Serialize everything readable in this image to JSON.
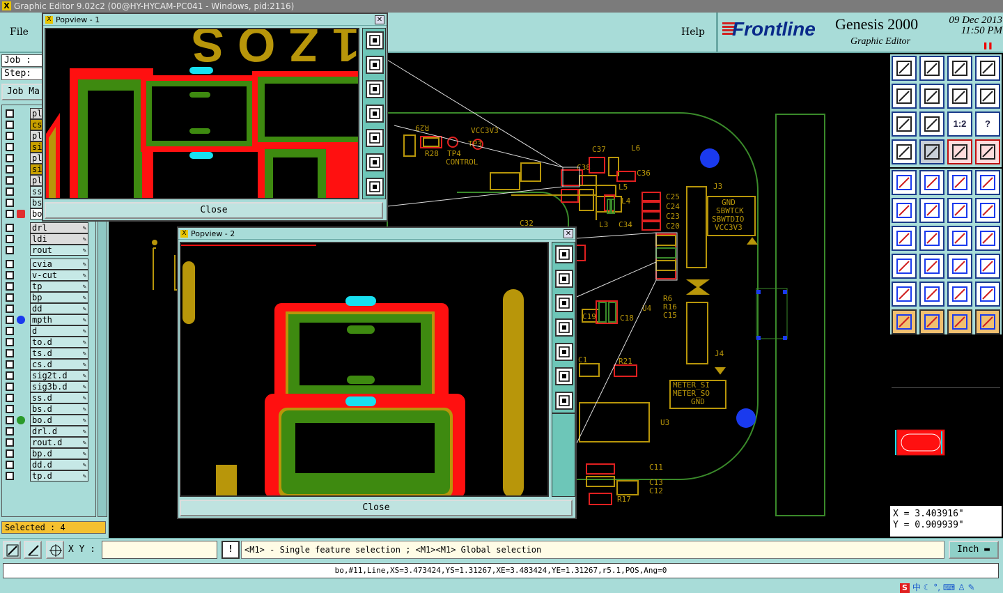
{
  "window": {
    "title": "Graphic Editor 9.02c2 (00@HY-HYCAM-PC041 - Windows, pid:2116)"
  },
  "menu": {
    "file": "File",
    "help": "Help"
  },
  "brand": {
    "logo": "Frontline",
    "product": "Genesis 2000",
    "subtitle": "Graphic Editor",
    "date": "09 Dec 2013",
    "time": "11:50 PM"
  },
  "job": {
    "job_label": "Job :",
    "step_label": "Step:",
    "job_manager_label": "Job Ma"
  },
  "layers": [
    {
      "name": "pl",
      "color": "",
      "alt": true
    },
    {
      "name": "cs",
      "color": "",
      "alt": false,
      "label_bg": "#c8a000"
    },
    {
      "name": "pl",
      "color": "",
      "alt": true
    },
    {
      "name": "si",
      "color": "",
      "alt": false,
      "label_bg": "#c8a000"
    },
    {
      "name": "pl",
      "color": "",
      "alt": true
    },
    {
      "name": "si",
      "color": "",
      "alt": false,
      "label_bg": "#c8a000"
    },
    {
      "name": "pl",
      "color": "",
      "alt": true
    },
    {
      "name": "ss",
      "color": "",
      "alt": false
    },
    {
      "name": "bs",
      "color": "",
      "alt": false
    },
    {
      "name": "bo",
      "color": "",
      "alt": false,
      "selected": true
    },
    {
      "name": "drl",
      "color": "",
      "alt": true
    },
    {
      "name": "ldi",
      "color": "",
      "alt": true
    },
    {
      "name": "rout",
      "color": "",
      "alt": false
    },
    {
      "name": "cvia",
      "color": "",
      "alt": false
    },
    {
      "name": "v-cut",
      "color": "",
      "alt": false
    },
    {
      "name": "tp",
      "color": "",
      "alt": false
    },
    {
      "name": "bp",
      "color": "",
      "alt": false
    },
    {
      "name": "dd",
      "color": "",
      "alt": false
    },
    {
      "name": "mpth",
      "color": "#1a3aee",
      "alt": false
    },
    {
      "name": "d",
      "color": "",
      "alt": false
    },
    {
      "name": "to.d",
      "color": "",
      "alt": false
    },
    {
      "name": "ts.d",
      "color": "",
      "alt": false
    },
    {
      "name": "cs.d",
      "color": "",
      "alt": false
    },
    {
      "name": "sig2t.d",
      "color": "",
      "alt": false
    },
    {
      "name": "sig3b.d",
      "color": "",
      "alt": false
    },
    {
      "name": "ss.d",
      "color": "",
      "alt": false
    },
    {
      "name": "bs.d",
      "color": "",
      "alt": false
    },
    {
      "name": "bo.d",
      "color": "#2a9a2a",
      "alt": false
    },
    {
      "name": "drl.d",
      "color": "",
      "alt": false
    },
    {
      "name": "rout.d",
      "color": "",
      "alt": false
    },
    {
      "name": "bp.d",
      "color": "",
      "alt": false
    },
    {
      "name": "dd.d",
      "color": "",
      "alt": false
    },
    {
      "name": "tp.d",
      "color": "",
      "alt": false
    }
  ],
  "selected_label": "Selected : 4",
  "popview1": {
    "title": "Popview - 1",
    "close_label": "Close",
    "text": "1 Z O S"
  },
  "popview2": {
    "title": "Popview - 2",
    "close_label": "Close"
  },
  "board_labels": {
    "r29": "R29",
    "vcc3v3": "VCC3V3",
    "tp3": "TP3",
    "tp4": "TP4",
    "r28": "R28",
    "control": "CONTROL",
    "c37": "C37",
    "l6": "L6",
    "c38": "C38",
    "c36": "C36",
    "l5": "L5",
    "l4": "L4",
    "c34": "C34",
    "l3": "L3",
    "c25": "C25",
    "c24": "C24",
    "c23": "C23",
    "c20": "C20",
    "c32": "C32",
    "j3": "J3",
    "gnd": "GND",
    "sbwtck": "SBWTCK",
    "sbwtdio": "SBWTDIO",
    "vcc3v3b": "VCC3V3",
    "c19": "C19",
    "c18": "C18",
    "r6": "R6",
    "r16": "R16",
    "c15": "C15",
    "u4": "U4",
    "j4": "J4",
    "c1": "C1",
    "r21": "R21",
    "meter_si": "METER_SI",
    "meter_so": "METER_SO",
    "gnd2": "GND",
    "u3": "U3",
    "c11": "C11",
    "c13": "C13",
    "c12": "C12",
    "r17": "R17"
  },
  "coords": {
    "x": "X = 3.403916\"",
    "y": "Y = 0.909939\""
  },
  "bottom": {
    "xy_label": "X Y :",
    "xy_value": "",
    "hint": "<M1> - Single feature selection ; <M1><M1> Global selection",
    "unit": "Inch"
  },
  "status": "bo,#11,Line,XS=3.473424,YS=1.31267,XE=3.483424,YE=1.31267,r5.1,POS,Ang=0",
  "tray": {
    "ime": "中"
  },
  "colors": {
    "panel": "#a8dcd8",
    "copper": "#b8960a",
    "mask_red": "#ff1010",
    "pad_green": "#3e8a10",
    "cyan": "#18e0f0",
    "via_blue": "#1a3aee"
  }
}
